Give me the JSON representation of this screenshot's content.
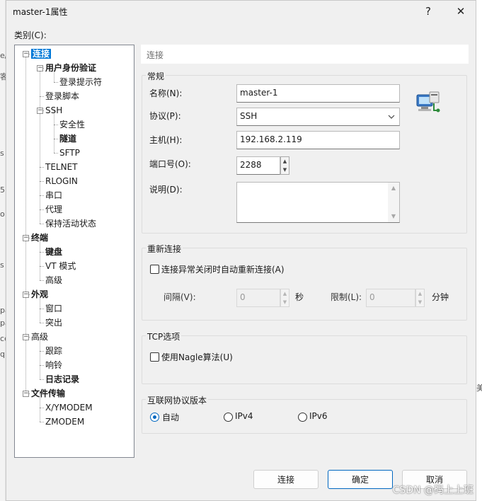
{
  "dialog": {
    "title": "master-1属性",
    "help_label": "?",
    "close_label": "✕"
  },
  "category_label": "类别(C):",
  "tree": {
    "items": [
      {
        "label": "连接",
        "level": 0,
        "expander": "−",
        "bold": true,
        "selected": true
      },
      {
        "label": "用户身份验证",
        "level": 1,
        "expander": "−",
        "bold": true
      },
      {
        "label": "登录提示符",
        "level": 2
      },
      {
        "label": "登录脚本",
        "level": 1
      },
      {
        "label": "SSH",
        "level": 1,
        "expander": "−"
      },
      {
        "label": "安全性",
        "level": 2
      },
      {
        "label": "隧道",
        "level": 2,
        "bold": true
      },
      {
        "label": "SFTP",
        "level": 2
      },
      {
        "label": "TELNET",
        "level": 1
      },
      {
        "label": "RLOGIN",
        "level": 1
      },
      {
        "label": "串口",
        "level": 1
      },
      {
        "label": "代理",
        "level": 1
      },
      {
        "label": "保持活动状态",
        "level": 1
      },
      {
        "label": "终端",
        "level": 0,
        "expander": "−",
        "bold": true
      },
      {
        "label": "键盘",
        "level": 1,
        "bold": true
      },
      {
        "label": "VT 模式",
        "level": 1
      },
      {
        "label": "高级",
        "level": 1
      },
      {
        "label": "外观",
        "level": 0,
        "expander": "−",
        "bold": true
      },
      {
        "label": "窗口",
        "level": 1
      },
      {
        "label": "突出",
        "level": 1
      },
      {
        "label": "高级",
        "level": 0,
        "expander": "−"
      },
      {
        "label": "跟踪",
        "level": 1
      },
      {
        "label": "响铃",
        "level": 1
      },
      {
        "label": "日志记录",
        "level": 1,
        "bold": true
      },
      {
        "label": "文件传输",
        "level": 0,
        "expander": "−",
        "bold": true
      },
      {
        "label": "X/YMODEM",
        "level": 1
      },
      {
        "label": "ZMODEM",
        "level": 1
      }
    ]
  },
  "header": {
    "text": "连接"
  },
  "general": {
    "title": "常规",
    "name_label": "名称(N):",
    "name_value": "master-1",
    "protocol_label": "协议(P):",
    "protocol_value": "SSH",
    "host_label": "主机(H):",
    "host_value": "192.168.2.119",
    "port_label": "端口号(O):",
    "port_value": "2288",
    "desc_label": "说明(D):",
    "desc_value": ""
  },
  "reconnect": {
    "title": "重新连接",
    "auto_label": "连接异常关闭时自动重新连接(A)",
    "auto_checked": false,
    "interval_label": "间隔(V):",
    "interval_value": "0",
    "interval_unit": "秒",
    "limit_label": "限制(L):",
    "limit_value": "0",
    "limit_unit": "分钟"
  },
  "tcp": {
    "title": "TCP选项",
    "nagle_label": "使用Nagle算法(U)",
    "nagle_checked": false
  },
  "ipver": {
    "title": "互联网协议版本",
    "options": [
      "自动",
      "IPv4",
      "IPv6"
    ],
    "selected": "自动"
  },
  "buttons": {
    "connect": "连接",
    "ok": "确定",
    "cancel": "取消"
  },
  "watermark": "CSDN @码上上班",
  "background_fragments": [
    "e/",
    "客",
    "s",
    "5",
    "o",
    "s",
    "pa",
    "pa",
    "ce",
    "ql",
    "美"
  ],
  "colors": {
    "selection": "#0078d7",
    "primary_border": "#0067c0",
    "dialog_bg": "#f0f0f0"
  }
}
